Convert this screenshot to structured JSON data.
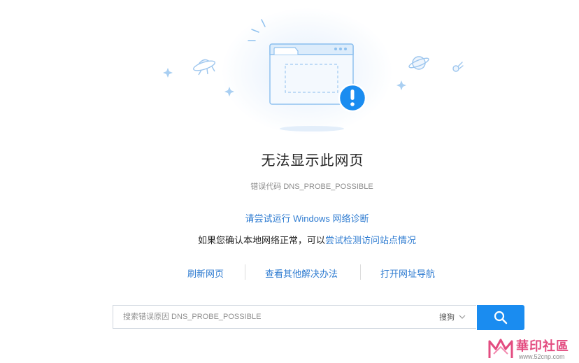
{
  "page": {
    "title": "无法显示此网页",
    "error_code": "错误代码 DNS_PROBE_POSSIBLE",
    "diagnose_link": "请尝试运行 Windows 网络诊断",
    "check_prefix": "如果您确认本地网络正常，可以",
    "check_link": "尝试检测访问站点情况"
  },
  "actions": {
    "refresh": "刷新网页",
    "other_solutions": "查看其他解决办法",
    "open_nav": "打开网址导航"
  },
  "search": {
    "placeholder": "搜索错误原因 DNS_PROBE_POSSIBLE",
    "engine": "搜狗"
  },
  "watermark": {
    "text": "華印社區",
    "url": "www.52cnp.com"
  },
  "colors": {
    "link": "#2f7cd1",
    "accent": "#1a8cf0",
    "illustration_line": "#8fc1ef",
    "alert": "#1a8cf0",
    "watermark": "#e34c80"
  },
  "icons": {
    "browser": "browser-window-icon",
    "alert": "exclamation-icon",
    "ufo": "ufo-icon",
    "planet": "planet-icon",
    "comet": "comet-icon",
    "sparkle": "sparkle-icon",
    "search": "search-icon",
    "chevron": "chevron-down-icon"
  }
}
